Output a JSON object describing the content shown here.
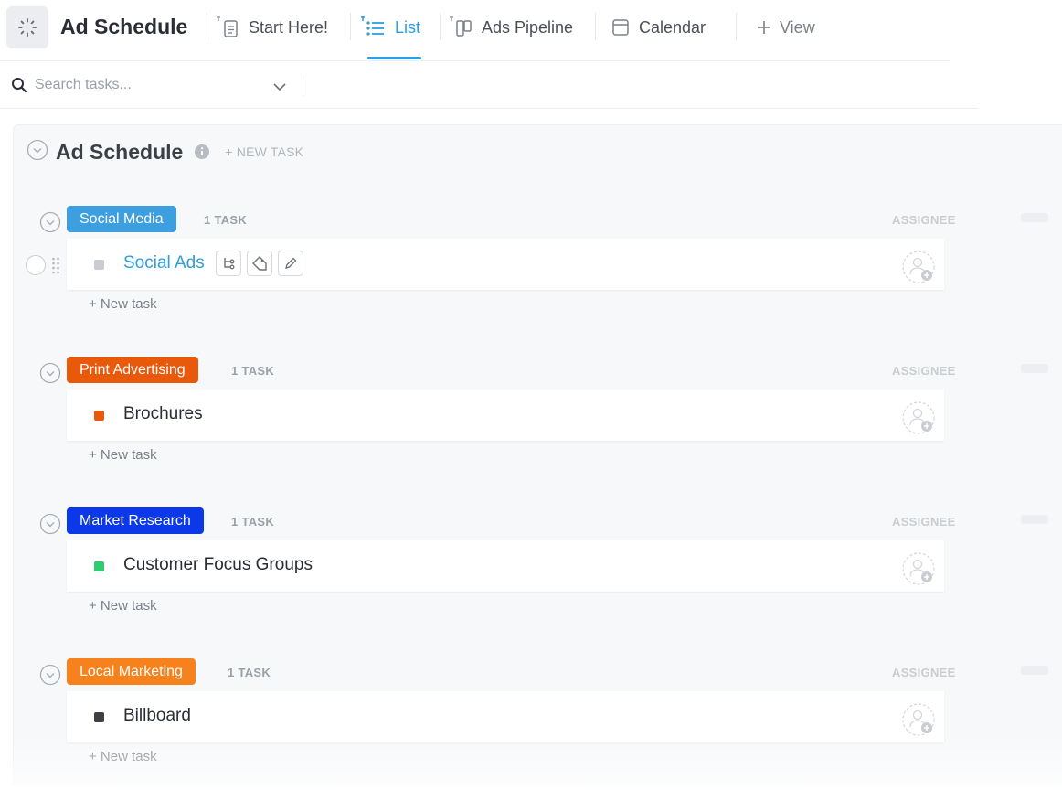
{
  "header": {
    "space_icon": "loading-dots-icon",
    "title": "Ad Schedule",
    "tabs": [
      {
        "label": "Start Here!",
        "icon": "doc-icon",
        "pinned": true,
        "active": false
      },
      {
        "label": "List",
        "icon": "list-icon",
        "pinned": true,
        "active": true
      },
      {
        "label": "Ads Pipeline",
        "icon": "board-icon",
        "pinned": true,
        "active": false
      },
      {
        "label": "Calendar",
        "icon": "calendar-icon",
        "pinned": false,
        "active": false
      },
      {
        "label": "View",
        "icon": "plus-icon",
        "pinned": false,
        "active": false
      }
    ]
  },
  "search": {
    "placeholder": "Search tasks..."
  },
  "list": {
    "title": "Ad Schedule",
    "new_task_label": "+ NEW TASK"
  },
  "columns": {
    "assignee": "ASSIGNEE"
  },
  "groups": [
    {
      "label": "Social Media",
      "color": "#3d9ee0",
      "count_label": "1 TASK",
      "task": {
        "name": "Social Ads",
        "status_color": "#c9ccd1",
        "hovered": true
      },
      "new_task": "+ New task"
    },
    {
      "label": "Print Advertising",
      "color": "#e8590c",
      "count_label": "1 TASK",
      "task": {
        "name": "Brochures",
        "status_color": "#e8590c",
        "hovered": false
      },
      "new_task": "+ New task"
    },
    {
      "label": "Market Research",
      "color": "#0b38e8",
      "count_label": "1 TASK",
      "task": {
        "name": "Customer Focus Groups",
        "status_color": "#2ecd6f",
        "hovered": false
      },
      "new_task": "+ New task"
    },
    {
      "label": "Local Marketing",
      "color": "#f7821d",
      "count_label": "1 TASK",
      "task": {
        "name": "Billboard",
        "status_color": "#3c3f44",
        "hovered": false
      },
      "new_task": "+ New task"
    }
  ],
  "task_actions": [
    "subtask-icon",
    "tag-icon",
    "edit-icon"
  ]
}
